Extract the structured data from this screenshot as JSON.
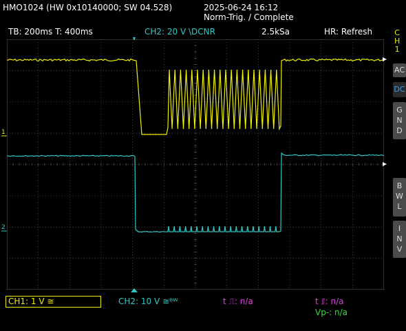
{
  "header": {
    "device": "HMO1024 (HW 0x10140000; SW 04.528)",
    "datetime": "2025-06-24 16:12",
    "trigger_status": "Norm-Trig. / Complete"
  },
  "info": {
    "timebase": "TB: 200ms  T: 400ms",
    "ch2_setting": "CH2: 20 V \\DCNR",
    "sample_rate": "2.5kSa",
    "acq_mode": "HR: Refresh"
  },
  "right_panel": {
    "channel_label": [
      "C",
      "H",
      "1"
    ],
    "ac": "AC",
    "dc": "DC",
    "gnd": [
      "G",
      "N",
      "D"
    ],
    "bwl": [
      "B",
      "W",
      "L"
    ],
    "inv": [
      "I",
      "N",
      "V"
    ]
  },
  "markers": {
    "ch1": "1",
    "ch2": "2"
  },
  "bottom": {
    "ch1": "CH1: 1 V ≅",
    "ch2": "CH2: 10 V ≅ᴮᵂ",
    "t_pos": "t ⎍: n/a",
    "t_neg": "t ⎎: n/a",
    "vpp": "Vp-: n/a"
  },
  "colors": {
    "ch1": "#f0f000",
    "ch2": "#2ec8c8",
    "grid": "#5a5a5a",
    "magenta": "#e040e0",
    "green": "#33dd33"
  }
}
